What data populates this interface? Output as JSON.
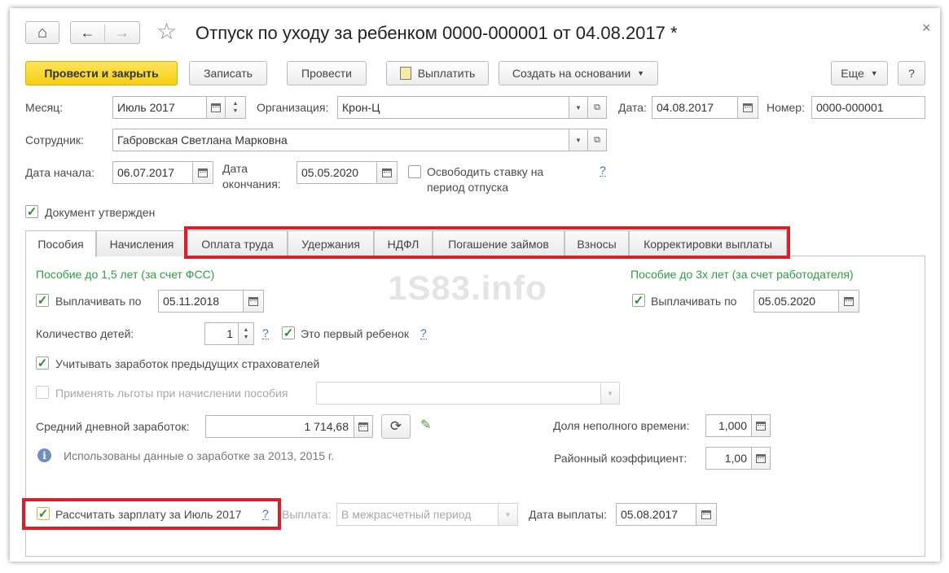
{
  "window": {
    "title": "Отпуск по уходу за ребенком 0000-000001 от 04.08.2017 *",
    "close_glyph": "×",
    "home_glyph": "⌂",
    "back_glyph": "←",
    "forward_glyph": "→",
    "star_glyph": "☆"
  },
  "toolbar": {
    "post_close": "Провести и закрыть",
    "save": "Записать",
    "post": "Провести",
    "pay": "Выплатить",
    "create_based": "Создать на основании",
    "more": "Еще",
    "help": "?"
  },
  "header": {
    "month_label": "Месяц:",
    "month_value": "Июль 2017",
    "org_label": "Организация:",
    "org_value": "Крон-Ц",
    "date_label": "Дата:",
    "date_value": "04.08.2017",
    "number_label": "Номер:",
    "number_value": "0000-000001",
    "employee_label": "Сотрудник:",
    "employee_value": "Габровская Светлана Марковна",
    "start_label": "Дата начала:",
    "start_value": "06.07.2017",
    "end_label_1": "Дата",
    "end_label_2": "окончания:",
    "end_value": "05.05.2020",
    "free_rate_1": "Освободить ставку на",
    "free_rate_2": "период отпуска",
    "approved_label": "Документ утвержден",
    "help_q": "?"
  },
  "tabs": [
    "Пособия",
    "Начисления",
    "Оплата труда",
    "Удержания",
    "НДФЛ",
    "Погашение займов",
    "Взносы",
    "Корректировки выплаты"
  ],
  "benefit": {
    "fss_title": "Пособие до 1,5 лет (за счет ФСС)",
    "employer_title": "Пособие до 3х лет (за счет работодателя)",
    "pay_until_label": "Выплачивать по",
    "pay_until_1": "05.11.2018",
    "pay_until_2": "05.05.2020",
    "children_label": "Количество детей:",
    "children_value": "1",
    "first_child": "Это первый ребенок",
    "prev_insurers": "Учитывать заработок предыдущих страхователей",
    "apply_benefits": "Применять льготы при начислении пособия",
    "avg_label": "Средний дневной заработок:",
    "avg_value": "1 714,68",
    "part_time_label": "Доля неполного времени:",
    "part_time_value": "1,000",
    "regional_label": "Районный коэффициент:",
    "regional_value": "1,00",
    "info_text": "Использованы данные о заработке за  2013,  2015 г.",
    "calc_salary": "Рассчитать зарплату за Июль 2017",
    "payment_label": "Выплата:",
    "payment_value": "В межрасчетный период",
    "pay_date_label": "Дата выплаты:",
    "pay_date_value": "05.08.2017"
  },
  "watermark": "1S83.info",
  "colors": {
    "primary_button": "#f5cf12",
    "highlight_red": "#d9202a",
    "section_green": "#2f9a45",
    "help_link": "#3d6fbf"
  }
}
